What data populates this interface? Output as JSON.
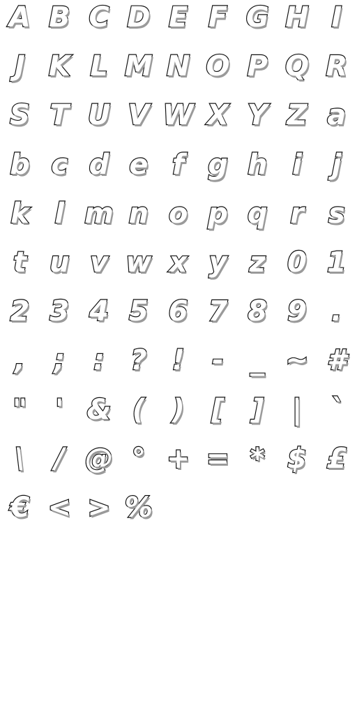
{
  "glyph_sheet": {
    "glyphs": [
      "A",
      "B",
      "C",
      "D",
      "E",
      "F",
      "G",
      "H",
      "I",
      "J",
      "K",
      "L",
      "M",
      "N",
      "O",
      "P",
      "Q",
      "R",
      "S",
      "T",
      "U",
      "V",
      "W",
      "X",
      "Y",
      "Z",
      "a",
      "b",
      "c",
      "d",
      "e",
      "f",
      "g",
      "h",
      "i",
      "j",
      "k",
      "l",
      "m",
      "n",
      "o",
      "p",
      "q",
      "r",
      "s",
      "t",
      "u",
      "v",
      "w",
      "x",
      "y",
      "z",
      "0",
      "1",
      "2",
      "3",
      "4",
      "5",
      "6",
      "7",
      "8",
      "9",
      ".",
      ",",
      ";",
      ":",
      "?",
      "!",
      "-",
      "_",
      "~",
      "#",
      "\"",
      "'",
      "&",
      "(",
      ")",
      "[",
      "]",
      "|",
      "`",
      "\\",
      "/",
      "@",
      "°",
      "+",
      "=",
      "*",
      "$",
      "£",
      "€",
      "<",
      ">",
      "%"
    ]
  }
}
